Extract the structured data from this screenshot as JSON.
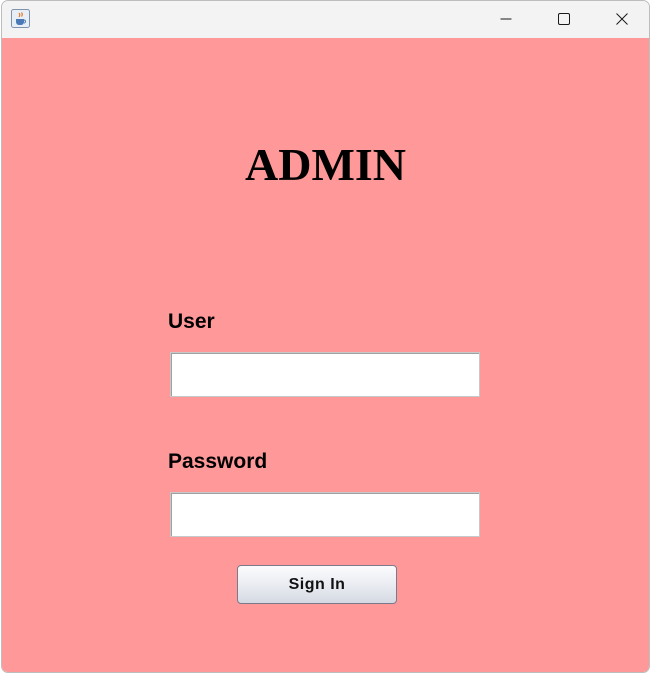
{
  "window": {
    "icon": "java-coffee-cup-icon",
    "controls": [
      "minimize-icon",
      "maximize-icon",
      "close-icon"
    ]
  },
  "form": {
    "title": "ADMIN",
    "user_label": "User",
    "user_value": "",
    "password_label": "Password",
    "password_value": "",
    "signin_label": "Sign In"
  },
  "colors": {
    "background": "#ff9999",
    "titlebar": "#f3f3f3"
  }
}
